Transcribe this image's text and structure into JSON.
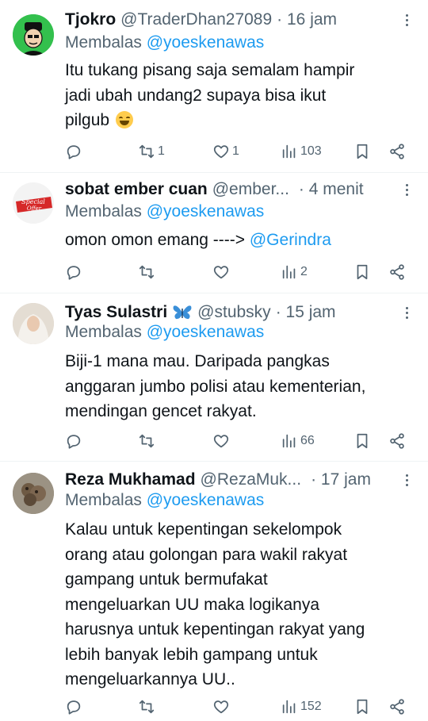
{
  "tweets": [
    {
      "name": "Tjokro",
      "badge": "",
      "handle": "@TraderDhan27089",
      "time": "· 16 jam",
      "reply_prefix": "Membalas",
      "reply_to": "@yoeskenawas",
      "lines": [
        "Itu tukang pisang saja semalam hampir",
        "jadi ubah undang2 supaya bisa ikut",
        "pilgub"
      ],
      "emoji": "grinning-sweat-emoji",
      "counts": {
        "reply": "",
        "retweet": "1",
        "like": "1",
        "views": "103"
      }
    },
    {
      "name": "sobat ember cuan",
      "badge": "",
      "handle": "@ember...",
      "time": "· 4 menit",
      "reply_prefix": "Membalas",
      "reply_to": "@yoeskenawas",
      "text_prefix": "omon omon emang ----> ",
      "text_mention": "@Gerindra",
      "avatar_text": [
        "Special",
        "Offer"
      ],
      "counts": {
        "reply": "",
        "retweet": "",
        "like": "",
        "views": "2"
      }
    },
    {
      "name": "Tyas Sulastri",
      "badge": "butterfly-emoji",
      "handle": "@stubsky",
      "time": "· 15 jam",
      "reply_prefix": "Membalas",
      "reply_to": "@yoeskenawas",
      "lines": [
        "Biji-1 mana mau. Daripada pangkas",
        "anggaran jumbo polisi atau kementerian,",
        "mendingan gencet rakyat."
      ],
      "counts": {
        "reply": "",
        "retweet": "",
        "like": "",
        "views": "66"
      }
    },
    {
      "name": "Reza Mukhamad",
      "badge": "",
      "handle": "@RezaMuk...",
      "time": "· 17 jam",
      "reply_prefix": "Membalas",
      "reply_to": "@yoeskenawas",
      "lines": [
        "Kalau untuk kepentingan sekelompok",
        "orang atau golongan para wakil rakyat",
        "gampang untuk bermufakat",
        "mengeluarkan UU maka logikanya",
        "harusnya untuk kepentingan rakyat yang",
        "lebih banyak lebih gampang untuk",
        "mengeluarkannya UU.."
      ],
      "counts": {
        "reply": "",
        "retweet": "",
        "like": "",
        "views": "152"
      }
    }
  ],
  "colors": {
    "link": "#1d9bf0",
    "muted": "#536471",
    "text": "#0f1419",
    "divider": "#eff3f4"
  }
}
